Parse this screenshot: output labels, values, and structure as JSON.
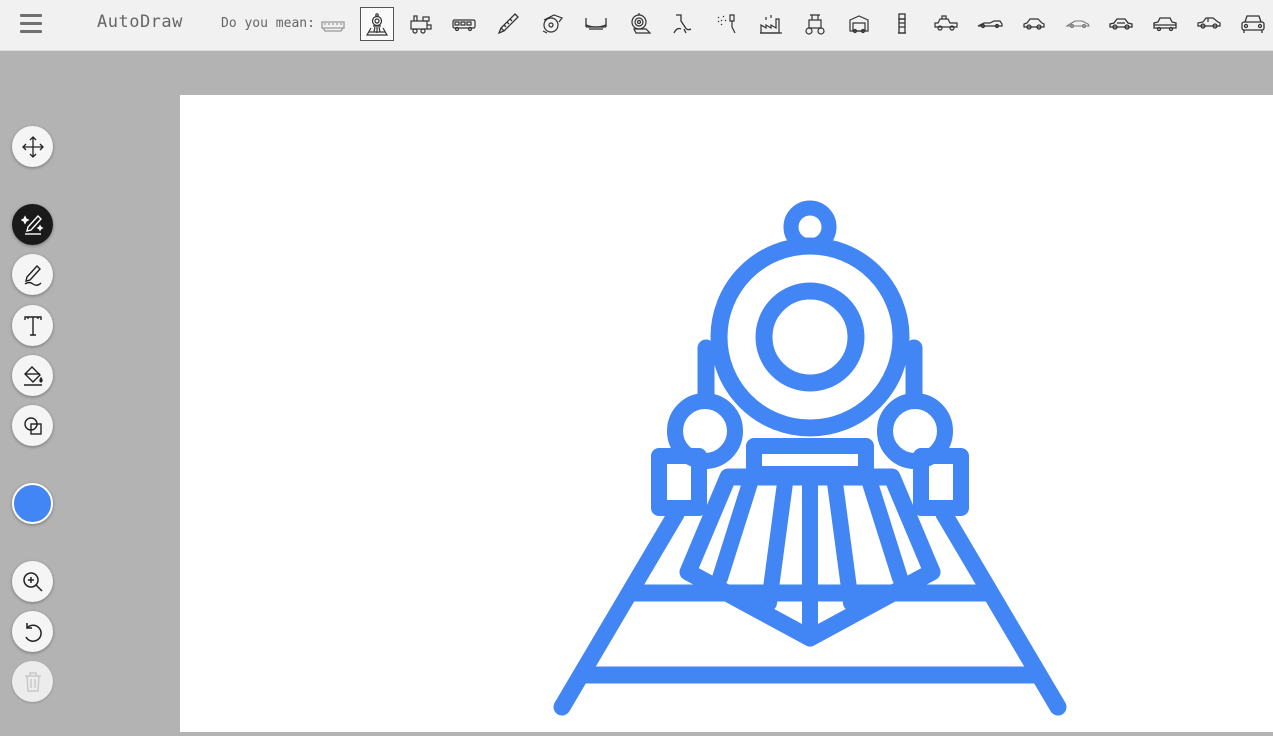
{
  "header": {
    "app_title": "AutoDraw",
    "suggest_label": "Do you mean:"
  },
  "suggestions": [
    {
      "icon": "boat-icon",
      "selected": false
    },
    {
      "icon": "locomotive-front-icon",
      "selected": true
    },
    {
      "icon": "steam-train-icon",
      "selected": false
    },
    {
      "icon": "bus-icon",
      "selected": false
    },
    {
      "icon": "saw-icon",
      "selected": false
    },
    {
      "icon": "circular-saw-icon",
      "selected": false
    },
    {
      "icon": "bridge-icon",
      "selected": false
    },
    {
      "icon": "snail-icon",
      "selected": false
    },
    {
      "icon": "crane-hook-icon",
      "selected": false
    },
    {
      "icon": "water-tap-icon",
      "selected": false
    },
    {
      "icon": "factory-icon",
      "selected": false
    },
    {
      "icon": "tractor-icon",
      "selected": false
    },
    {
      "icon": "truck-icon",
      "selected": false
    },
    {
      "icon": "lighthouse-icon",
      "selected": false
    },
    {
      "icon": "jeep-icon",
      "selected": false
    },
    {
      "icon": "race-car-icon",
      "selected": false
    },
    {
      "icon": "car-side-icon",
      "selected": false
    },
    {
      "icon": "sports-car-icon",
      "selected": false
    },
    {
      "icon": "sedan-icon",
      "selected": false
    },
    {
      "icon": "coupe-icon",
      "selected": false
    },
    {
      "icon": "hatchback-icon",
      "selected": false
    },
    {
      "icon": "car-front-icon",
      "selected": false
    }
  ],
  "toolbar": {
    "tools": [
      {
        "name": "move-tool",
        "icon": "move-icon"
      },
      {
        "name": "autodraw-tool",
        "icon": "autodraw-icon",
        "active": true
      },
      {
        "name": "draw-tool",
        "icon": "pencil-icon"
      },
      {
        "name": "type-tool",
        "icon": "text-icon"
      },
      {
        "name": "fill-tool",
        "icon": "paint-bucket-icon"
      },
      {
        "name": "shape-tool",
        "icon": "shapes-icon"
      },
      {
        "name": "zoom-tool",
        "icon": "zoom-icon"
      },
      {
        "name": "undo-button",
        "icon": "undo-icon"
      },
      {
        "name": "delete-button",
        "icon": "trash-icon",
        "disabled": true
      }
    ],
    "selected_color": "#4285f4"
  },
  "colors": {
    "drawing_stroke": "#4285f4",
    "canvas_background": "#ffffff",
    "workspace_background": "#b3b3b3",
    "header_background": "#f1f1f1"
  }
}
